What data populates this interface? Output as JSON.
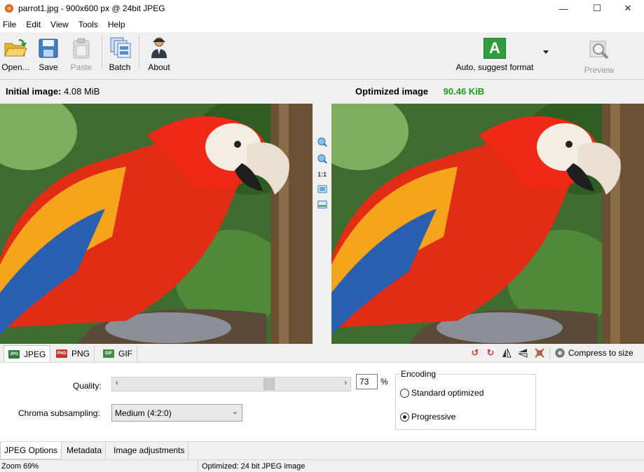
{
  "window": {
    "title": "parrot1.jpg - 900x600 px @ 24bit JPEG",
    "minimize": "—",
    "maximize": "☐",
    "close": "✕"
  },
  "menu": [
    "File",
    "Edit",
    "View",
    "Tools",
    "Help"
  ],
  "toolbar": {
    "open": "Open...",
    "save": "Save",
    "paste": "Paste",
    "batch": "Batch",
    "about": "About",
    "format_label": "Auto, suggest format",
    "format_letter": "A",
    "preview": "Preview"
  },
  "info": {
    "initial_label": "Initial image:",
    "initial_size": "4.08 MiB",
    "optimized_label": "Optimized image",
    "optimized_size": "90.46 KiB"
  },
  "zoom_strip": {
    "one_to_one": "1:1"
  },
  "formats": {
    "jpeg": "JPEG",
    "png": "PNG",
    "gif": "GIF",
    "compress": "Compress to size"
  },
  "options": {
    "quality_label": "Quality:",
    "quality_value": "73",
    "quality_fraction": 0.69,
    "percent": "%",
    "chroma_label": "Chroma subsampling:",
    "chroma_value": "Medium (4:2:0)",
    "encoding_title": "Encoding",
    "standard": "Standard optimized",
    "progressive": "Progressive",
    "selected_encoding": "progressive"
  },
  "bottom_tabs": [
    "JPEG Options",
    "Metadata",
    "Image adjustments"
  ],
  "status": {
    "zoom": "Zoom 69%",
    "info": "Optimized: 24 bit JPEG image"
  },
  "colors": {
    "accent_green": "#1a9a1a",
    "format_icon_green": "#2e9e3e"
  }
}
